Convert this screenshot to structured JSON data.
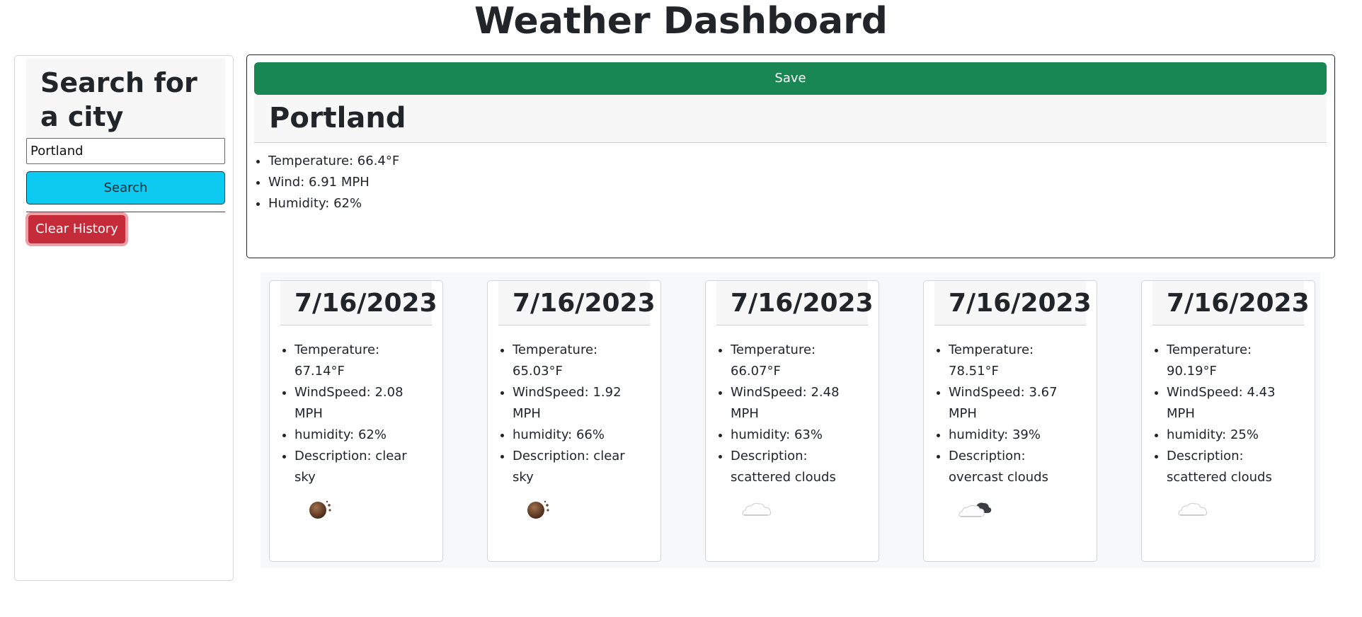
{
  "page": {
    "title": "Weather Dashboard"
  },
  "sidebar": {
    "heading": "Search for a city",
    "search_value": "Portland",
    "search_button_label": "Search",
    "clear_button_label": "Clear History"
  },
  "current": {
    "save_label": "Save",
    "city": "Portland",
    "temperature": "Temperature: 66.4°F",
    "wind": "Wind: 6.91 MPH",
    "humidity": "Humidity: 62%"
  },
  "forecast": [
    {
      "date": "7/16/2023",
      "temperature": "Temperature: 67.14°F",
      "windspeed": "WindSpeed: 2.08 MPH",
      "humidity": "humidity: 62%",
      "description": "Description: clear sky",
      "icon": "clear-night-icon"
    },
    {
      "date": "7/16/2023",
      "temperature": "Temperature: 65.03°F",
      "windspeed": "WindSpeed: 1.92 MPH",
      "humidity": "humidity: 66%",
      "description": "Description: clear sky",
      "icon": "clear-night-icon"
    },
    {
      "date": "7/16/2023",
      "temperature": "Temperature: 66.07°F",
      "windspeed": "WindSpeed: 2.48 MPH",
      "humidity": "humidity: 63%",
      "description": "Description: scattered clouds",
      "icon": "cloud-icon"
    },
    {
      "date": "7/16/2023",
      "temperature": "Temperature: 78.51°F",
      "windspeed": "WindSpeed: 3.67 MPH",
      "humidity": "humidity: 39%",
      "description": "Description: overcast clouds",
      "icon": "overcast-clouds-icon"
    },
    {
      "date": "7/16/2023",
      "temperature": "Temperature: 90.19°F",
      "windspeed": "WindSpeed: 4.43 MPH",
      "humidity": "humidity: 25%",
      "description": "Description: scattered clouds",
      "icon": "cloud-icon"
    }
  ],
  "colors": {
    "save_button": "#198754",
    "search_button": "#0dcaf0",
    "clear_button": "#c62b3a"
  }
}
